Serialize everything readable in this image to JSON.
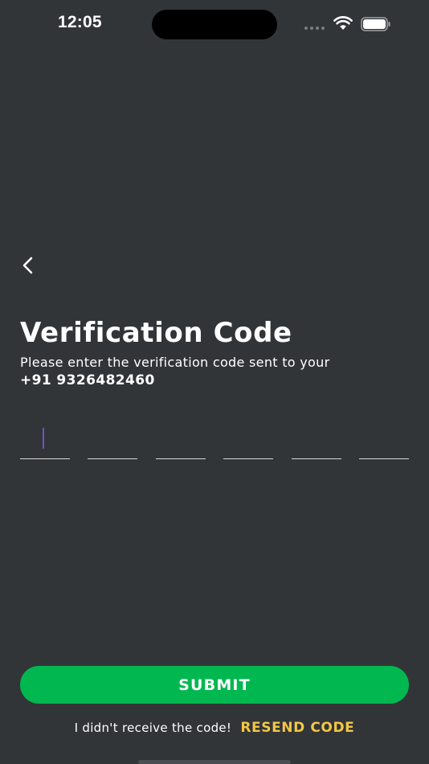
{
  "status_bar": {
    "time": "12:05",
    "icons": [
      "signal-dots-icon",
      "wifi-icon",
      "battery-icon"
    ]
  },
  "navigation": {
    "back_icon": "chevron-left-icon"
  },
  "header": {
    "title": "Verification Code",
    "subtitle": "Please enter the verification code sent to your",
    "phone": "+91 9326482460"
  },
  "otp": {
    "digit_count": 6,
    "digits": [
      "",
      "",
      "",
      "",
      "",
      ""
    ],
    "focused_index": 0
  },
  "actions": {
    "submit_label": "SUBMIT",
    "resend_prompt": "I didn't receive the code!",
    "resend_label": "RESEND CODE"
  },
  "colors": {
    "background": "#323538",
    "primary": "#00B84F",
    "accent": "#F2C744",
    "cursor": "#6B55C8",
    "underline": "#D7D9DC"
  }
}
